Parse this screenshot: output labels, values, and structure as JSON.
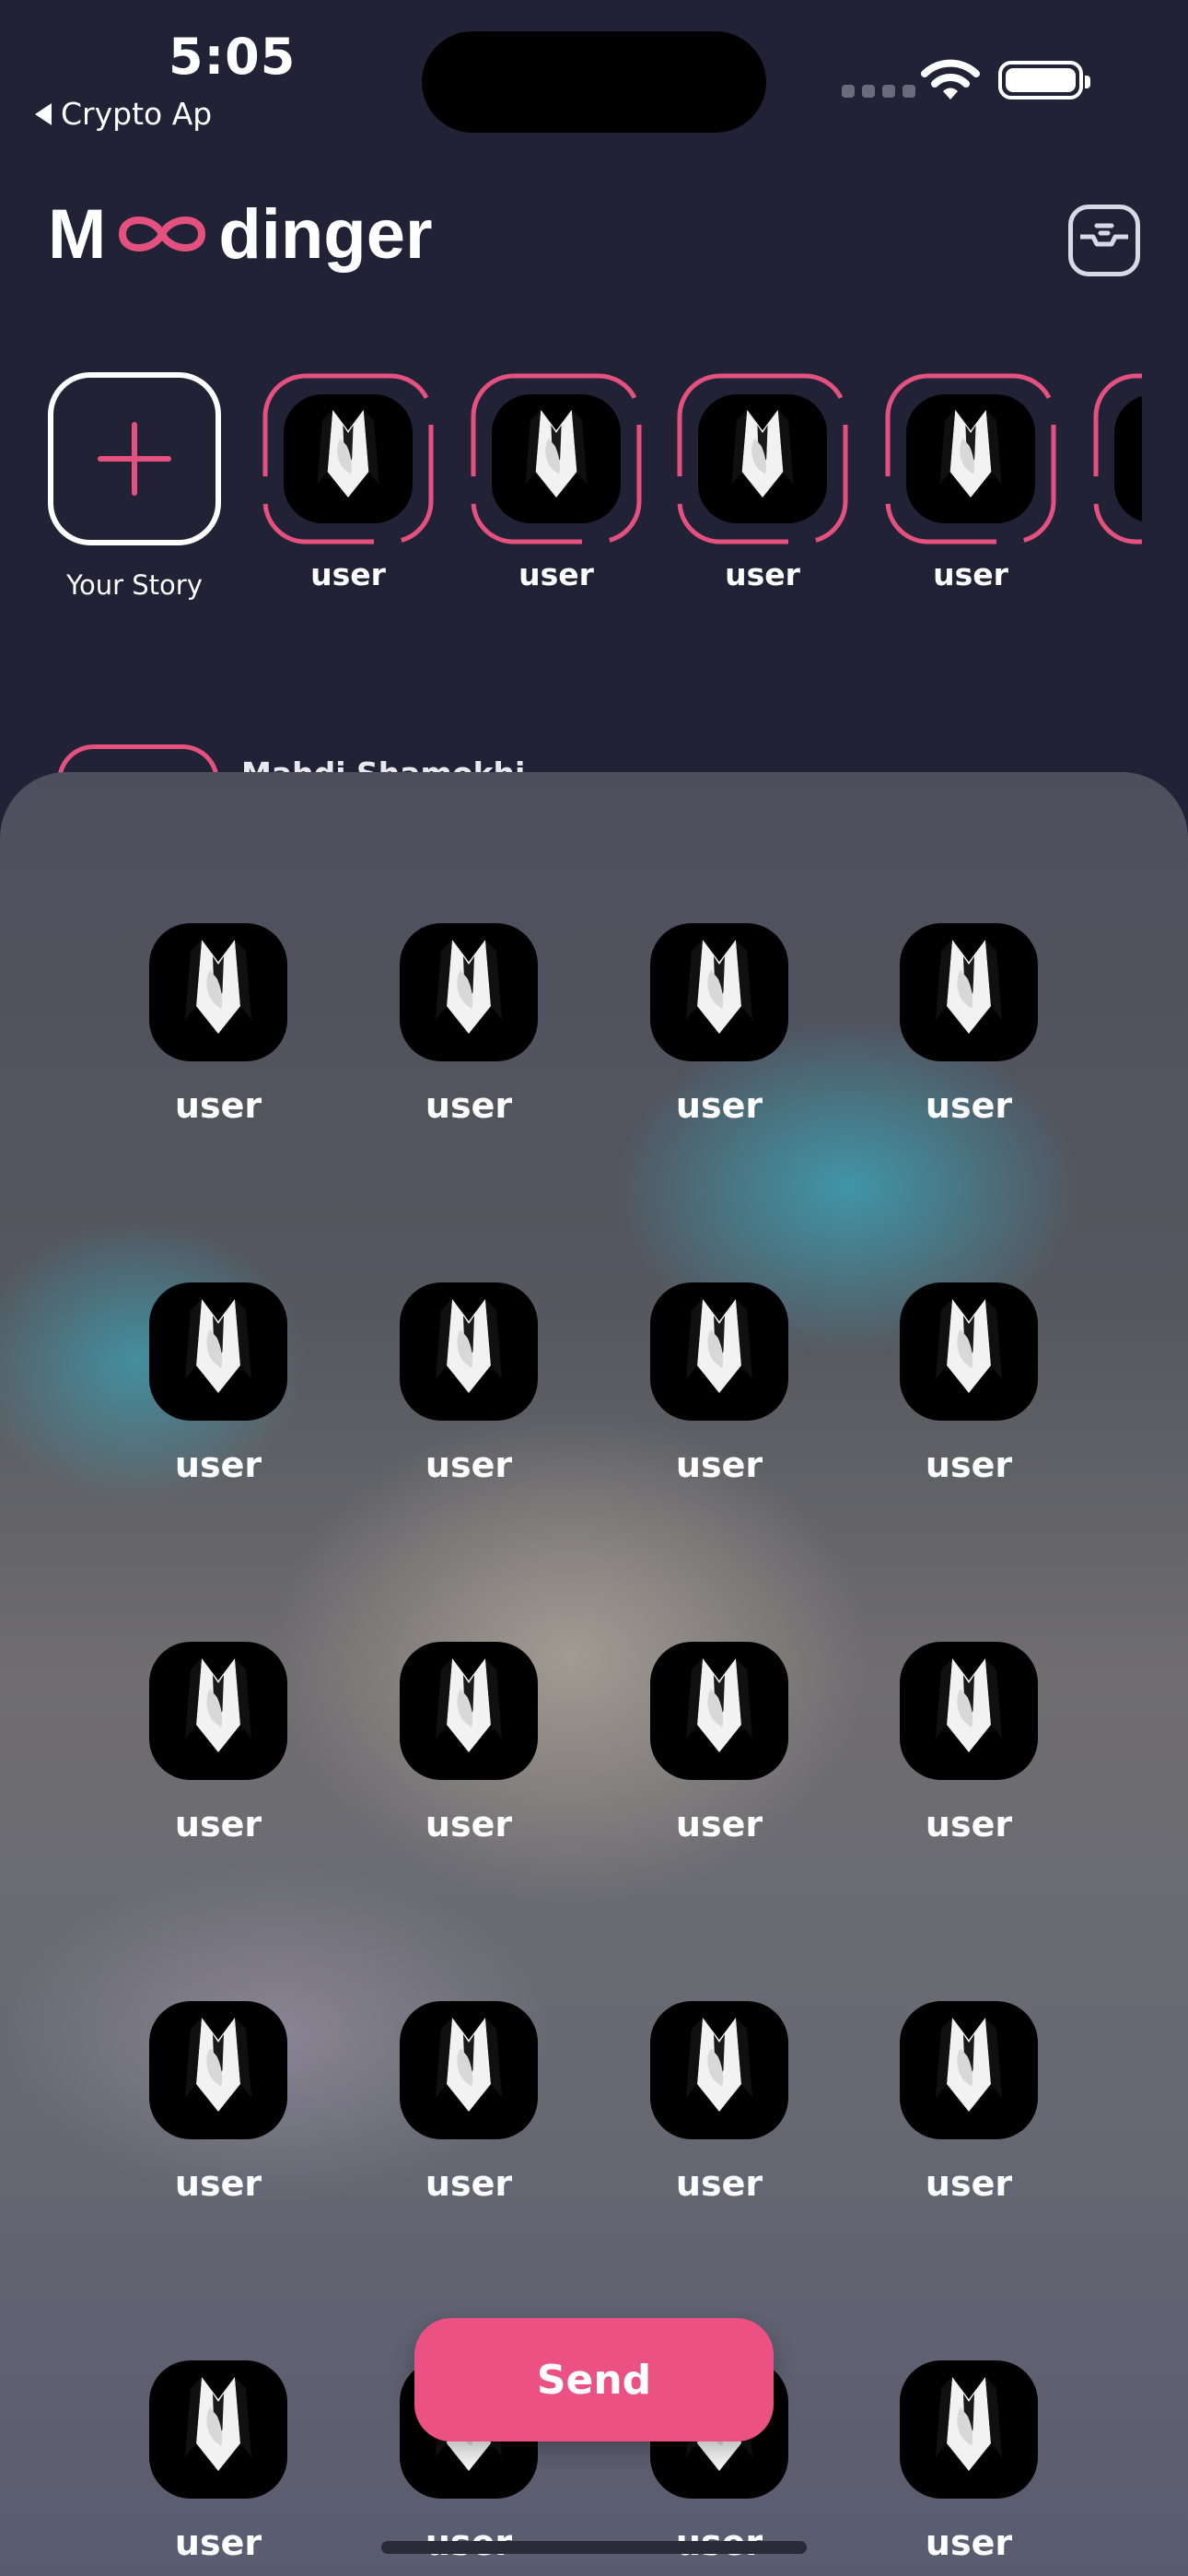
{
  "status_bar": {
    "time": "5:05",
    "back_app": "Crypto Ap"
  },
  "header": {
    "logo_start": "M",
    "logo_end": "dinger"
  },
  "stories": {
    "add_label": "Your Story",
    "items": [
      {
        "name": "user"
      },
      {
        "name": "user"
      },
      {
        "name": "user"
      },
      {
        "name": "user"
      }
    ]
  },
  "chat_list": {
    "peek_name": "Mahdi Shamokhi"
  },
  "share_sheet": {
    "users": [
      "user",
      "user",
      "user",
      "user",
      "user",
      "user",
      "user",
      "user",
      "user",
      "user",
      "user",
      "user",
      "user",
      "user",
      "user",
      "user",
      "user",
      "user",
      "user",
      "user"
    ],
    "send_label": "Send"
  },
  "colors": {
    "accent": "#eb5182",
    "background": "#222236"
  }
}
